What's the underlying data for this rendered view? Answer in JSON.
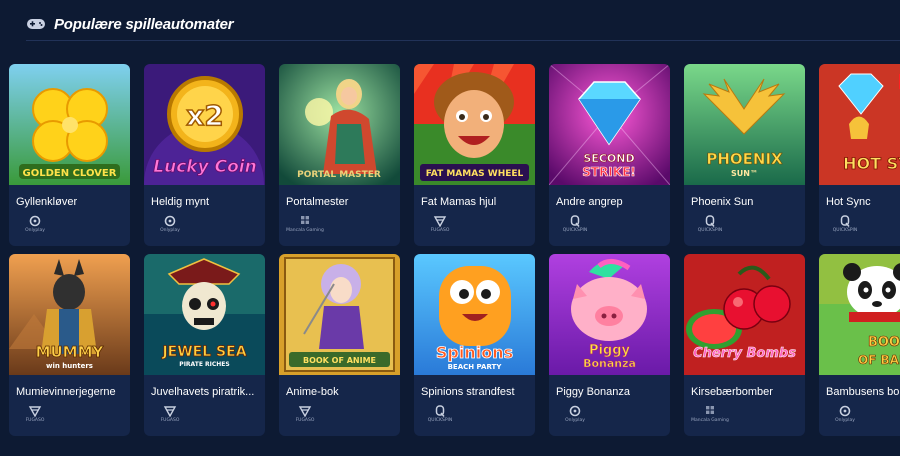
{
  "section": {
    "title": "Populære spilleautomater",
    "icon": "gamepad-icon"
  },
  "games": [
    {
      "name": "Gyllenkløver",
      "logo": "GOLDEN CLOVER",
      "provider": "Onlyplay",
      "provider_icon": "onlyplay-icon",
      "theme": "clover"
    },
    {
      "name": "Heldig mynt",
      "logo": "Lucky Coin",
      "badge": "x2",
      "provider": "Onlyplay",
      "provider_icon": "onlyplay-icon",
      "theme": "coin"
    },
    {
      "name": "Portalmester",
      "logo": "PORTAL MASTER",
      "provider": "Mancala Gaming",
      "provider_icon": "mancala-icon",
      "theme": "portal"
    },
    {
      "name": "Fat Mamas hjul",
      "logo": "FAT MAMAS WHEEL",
      "provider": "FUGASO",
      "provider_icon": "fugaso-icon",
      "theme": "mama"
    },
    {
      "name": "Andre angrep",
      "logo": "SECOND STRIKE!",
      "provider": "QUICKSPIN",
      "provider_icon": "quickspin-icon",
      "theme": "diamond"
    },
    {
      "name": "Phoenix Sun",
      "logo": "PHOENIX SUN",
      "provider": "QUICKSPIN",
      "provider_icon": "quickspin-icon",
      "theme": "phoenix"
    },
    {
      "name": "Hot Sync",
      "logo": "HOT SYNC",
      "provider": "QUICKSPIN",
      "provider_icon": "quickspin-icon",
      "theme": "hotsync"
    },
    {
      "name": "Mumievinnerjegerne",
      "logo": "MUMMY",
      "sublogo": "win hunters",
      "provider": "FUGASO",
      "provider_icon": "fugaso-icon",
      "theme": "mummy"
    },
    {
      "name": "Juvelhavets piratrik...",
      "logo": "JEWEL SEA",
      "sublogo": "PIRATE RICHES",
      "provider": "FUGASO",
      "provider_icon": "fugaso-icon",
      "theme": "pirate"
    },
    {
      "name": "Anime-bok",
      "logo": "BOOK OF ANIME",
      "provider": "FUGASO",
      "provider_icon": "fugaso-icon",
      "theme": "anime"
    },
    {
      "name": "Spinions strandfest",
      "logo": "Spinions",
      "sublogo": "BEACH PARTY",
      "provider": "QUICKSPIN",
      "provider_icon": "quickspin-icon",
      "theme": "spinions"
    },
    {
      "name": "Piggy Bonanza",
      "logo": "Piggy Bonanza",
      "provider": "Onlyplay",
      "provider_icon": "onlyplay-icon",
      "theme": "piggy"
    },
    {
      "name": "Kirsebærbomber",
      "logo": "Cherry Bombs",
      "provider": "Mancala Gaming",
      "provider_icon": "mancala-icon",
      "theme": "cherry"
    },
    {
      "name": "Bambusens bo",
      "logo": "BOOK OF BAMB",
      "provider": "Onlyplay",
      "provider_icon": "onlyplay-icon",
      "theme": "panda"
    }
  ],
  "colors": {
    "background": "#0d1a33",
    "card": "#15264a",
    "divider": "#213258",
    "provider_text": "#9aa6c0"
  }
}
